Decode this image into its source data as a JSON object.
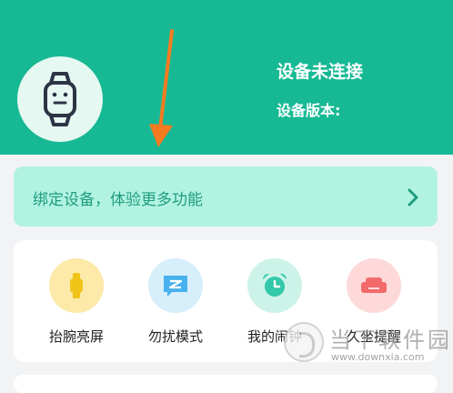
{
  "device": {
    "status": "设备未连接",
    "version_label": "设备版本:",
    "icon": "smartwatch-icon"
  },
  "bind_banner": {
    "text": "绑定设备，体验更多功能",
    "icon": "chevron-right-icon"
  },
  "features": [
    {
      "label": "抬腕亮屏",
      "icon": "wrist-raise-watch-icon",
      "bg": "#fde9a8",
      "fg": "#f0c419"
    },
    {
      "label": "勿扰模式",
      "icon": "do-not-disturb-message-icon",
      "bg": "#d7eefb",
      "fg": "#49b2ee"
    },
    {
      "label": "我的闹钟",
      "icon": "alarm-clock-icon",
      "bg": "#cdf3e9",
      "fg": "#33c8a9"
    },
    {
      "label": "久坐提醒",
      "icon": "sofa-icon",
      "bg": "#fdd9d9",
      "fg": "#f36a6a"
    }
  ],
  "watermark": {
    "text": "当下软件园",
    "url": "www.downxia.com"
  },
  "colors": {
    "header": "#16b994",
    "banner": "#b1f3e0",
    "arrow": "#f47b20"
  }
}
